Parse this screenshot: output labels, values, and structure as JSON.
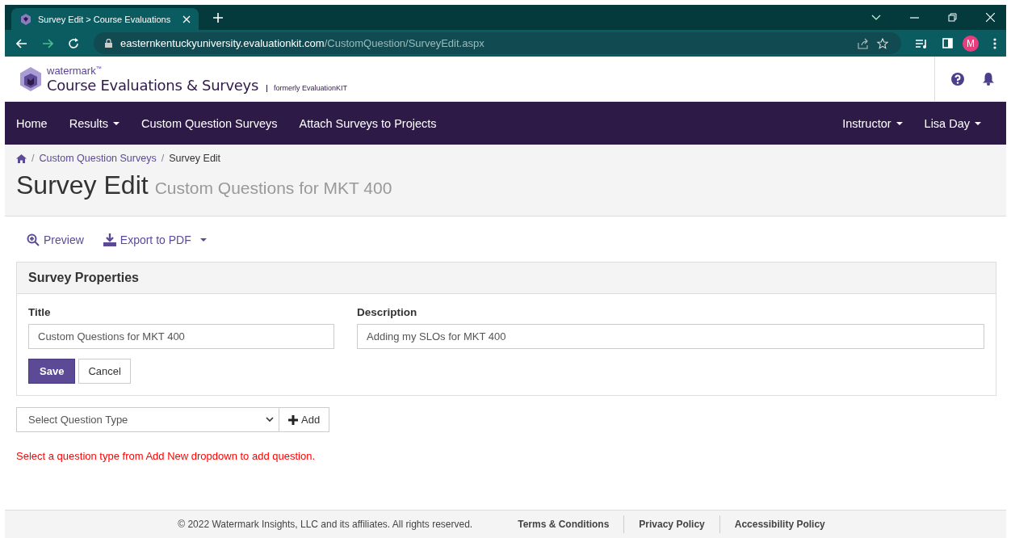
{
  "browser": {
    "tab_title": "Survey Edit > Course Evaluations",
    "url_host": "easternkentuckyuniversity.evaluationkit.com",
    "url_path": "/CustomQuestion/SurveyEdit.aspx",
    "profile_initial": "M"
  },
  "header": {
    "brand": "watermark",
    "brand_mark": "™",
    "product": "Course Evaluations & Surveys",
    "formerly": "formerly EvaluationKIT"
  },
  "nav": {
    "left": [
      {
        "label": "Home",
        "has_menu": false
      },
      {
        "label": "Results",
        "has_menu": true
      },
      {
        "label": "Custom Question Surveys",
        "has_menu": false
      },
      {
        "label": "Attach Surveys to Projects",
        "has_menu": false
      }
    ],
    "right": [
      {
        "label": "Instructor",
        "has_menu": true
      },
      {
        "label": "Lisa Day",
        "has_menu": true
      }
    ]
  },
  "breadcrumb": [
    "Custom Question Surveys",
    "Survey Edit"
  ],
  "breadcrumb_separator": "/",
  "page_title": "Survey Edit",
  "page_subtitle": "Custom Questions for MKT 400",
  "toolbar": [
    {
      "kind": "preview",
      "label": "Preview",
      "has_menu": false
    },
    {
      "kind": "export",
      "label": "Export to PDF",
      "has_menu": true
    }
  ],
  "panel": {
    "heading": "Survey Properties",
    "fields": [
      {
        "label": "Title",
        "value": "Custom Questions for MKT 400"
      },
      {
        "label": "Description",
        "value": "Adding my SLOs for MKT 400"
      }
    ],
    "save": "Save",
    "cancel": "Cancel"
  },
  "question_select": {
    "placeholder": "Select Question Type",
    "add": "Add"
  },
  "error": "Select a question type from Add New dropdown to add question.",
  "footer": {
    "copyright": "© 2022 Watermark Insights, LLC and its affiliates. All rights reserved.",
    "links": [
      "Terms & Conditions",
      "Privacy Policy",
      "Accessibility Policy"
    ]
  }
}
